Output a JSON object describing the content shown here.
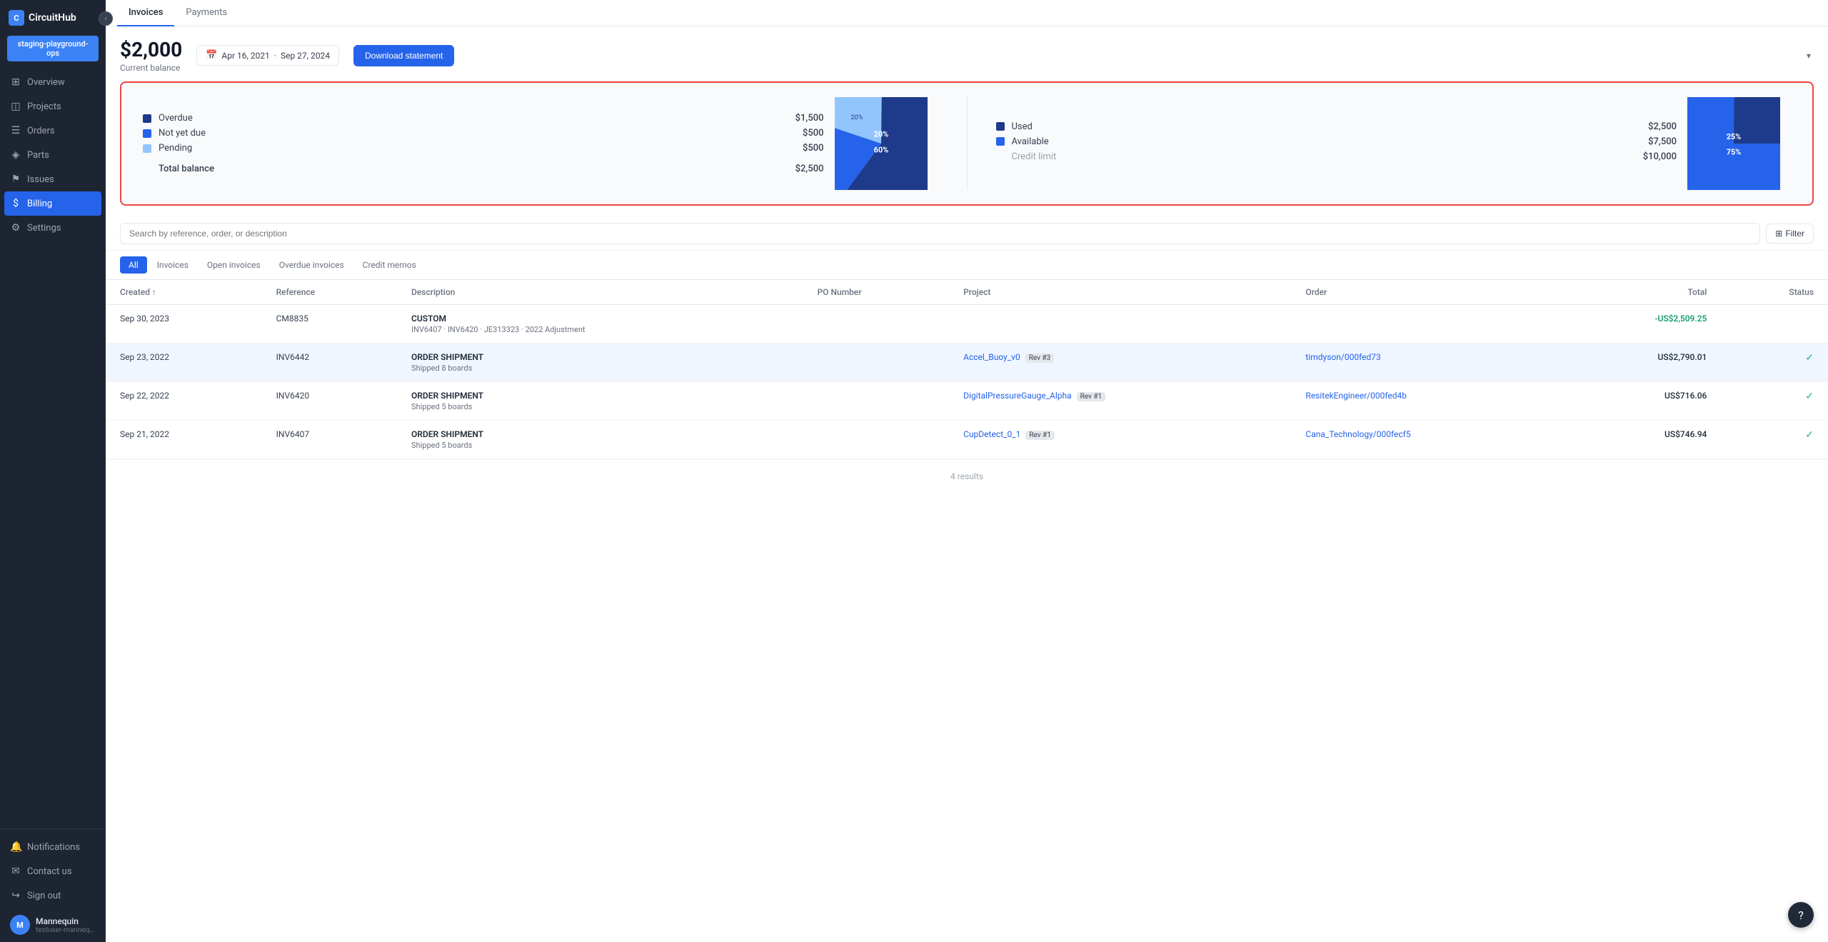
{
  "app": {
    "name": "CircuitHub",
    "logo_letter": "C"
  },
  "sidebar": {
    "workspace": "staging-playground-ops",
    "nav_items": [
      {
        "id": "overview",
        "label": "Overview",
        "icon": "⊞"
      },
      {
        "id": "projects",
        "label": "Projects",
        "icon": "◫"
      },
      {
        "id": "orders",
        "label": "Orders",
        "icon": "📋"
      },
      {
        "id": "parts",
        "label": "Parts",
        "icon": "⚙"
      },
      {
        "id": "issues",
        "label": "Issues",
        "icon": "⚠"
      },
      {
        "id": "billing",
        "label": "Billing",
        "icon": "$",
        "active": true
      },
      {
        "id": "settings",
        "label": "Settings",
        "icon": "⚙"
      }
    ],
    "bottom_items": [
      {
        "id": "notifications",
        "label": "Notifications",
        "icon": "🔔"
      },
      {
        "id": "contact",
        "label": "Contact us",
        "icon": "✉"
      },
      {
        "id": "signout",
        "label": "Sign out",
        "icon": "↪"
      }
    ],
    "user": {
      "name": "Mannequin",
      "email": "testuser-mannequin@circ...",
      "avatar_letter": "M"
    }
  },
  "header": {
    "tabs": [
      {
        "id": "invoices",
        "label": "Invoices",
        "active": true
      },
      {
        "id": "payments",
        "label": "Payments"
      }
    ],
    "balance": {
      "amount": "$2,000",
      "label": "Current balance"
    },
    "date_range": {
      "start": "Apr 16, 2021",
      "separator": "·",
      "end": "Sep 27, 2024"
    },
    "download_btn": "Download statement"
  },
  "summary": {
    "left": {
      "items": [
        {
          "label": "Overdue",
          "value": "$1,500",
          "color": "#1e3a8a"
        },
        {
          "label": "Not yet due",
          "value": "$500",
          "color": "#2563eb"
        },
        {
          "label": "Pending",
          "value": "$500",
          "color": "#93c5fd"
        }
      ],
      "total_label": "Total balance",
      "total_value": "$2,500"
    },
    "chart1": {
      "segments": [
        {
          "label": "Overdue 60%",
          "percent": 60,
          "color": "#1e3a8a"
        },
        {
          "label": "Not yet due 20%",
          "percent": 20,
          "color": "#2563eb"
        },
        {
          "label": "Pending 20%",
          "percent": 20,
          "color": "#93c5fd"
        }
      ]
    },
    "right": {
      "items": [
        {
          "label": "Used",
          "value": "$2,500",
          "color": "#1e3a8a"
        },
        {
          "label": "Available",
          "value": "$7,500",
          "color": "#2563eb"
        }
      ],
      "credit_limit_label": "Credit limit",
      "credit_limit_value": "$10,000"
    },
    "chart2": {
      "segments": [
        {
          "label": "Used 25%",
          "percent": 25,
          "color": "#1e3a8a"
        },
        {
          "label": "Available 75%",
          "percent": 75,
          "color": "#2563eb"
        }
      ]
    }
  },
  "filter": {
    "search_placeholder": "Search by reference, order, or description",
    "filter_btn": "Filter"
  },
  "sub_tabs": [
    {
      "id": "all",
      "label": "All",
      "active": true
    },
    {
      "id": "invoices",
      "label": "Invoices"
    },
    {
      "id": "open_invoices",
      "label": "Open invoices"
    },
    {
      "id": "overdue_invoices",
      "label": "Overdue invoices"
    },
    {
      "id": "credit_memos",
      "label": "Credit memos"
    }
  ],
  "table": {
    "columns": [
      {
        "id": "created",
        "label": "Created ↑"
      },
      {
        "id": "reference",
        "label": "Reference"
      },
      {
        "id": "description",
        "label": "Description"
      },
      {
        "id": "po_number",
        "label": "PO Number"
      },
      {
        "id": "project",
        "label": "Project"
      },
      {
        "id": "order",
        "label": "Order"
      },
      {
        "id": "total",
        "label": "Total",
        "align": "right"
      },
      {
        "id": "status",
        "label": "Status",
        "align": "right"
      }
    ],
    "rows": [
      {
        "created": "Sep 30, 2023",
        "reference": "CM8835",
        "desc_title": "CUSTOM",
        "desc_sub": "INV6407 · INV6420 · JE313323 · 2022 Adjustment",
        "po_number": "",
        "project": "",
        "project_link": false,
        "order": "",
        "order_link": false,
        "total": "-US$2,509.25",
        "total_class": "negative",
        "status": "",
        "highlighted": false
      },
      {
        "created": "Sep 23, 2022",
        "reference": "INV6442",
        "desc_title": "ORDER SHIPMENT",
        "desc_sub": "Shipped 8 boards",
        "po_number": "",
        "project": "Accel_Buoy_v0",
        "project_rev": "Rev #3",
        "project_link": true,
        "order": "timdyson/000fed73",
        "order_link": true,
        "total": "US$2,790.01",
        "total_class": "positive",
        "status": "✓",
        "highlighted": true
      },
      {
        "created": "Sep 22, 2022",
        "reference": "INV6420",
        "desc_title": "ORDER SHIPMENT",
        "desc_sub": "Shipped 5 boards",
        "po_number": "",
        "project": "DigitalPressureGauge_Alpha",
        "project_rev": "Rev #1",
        "project_link": true,
        "order": "ResitekEngineer/000fed4b",
        "order_link": true,
        "total": "US$716.06",
        "total_class": "positive",
        "status": "✓",
        "highlighted": false
      },
      {
        "created": "Sep 21, 2022",
        "reference": "INV6407",
        "desc_title": "ORDER SHIPMENT",
        "desc_sub": "Shipped 5 boards",
        "po_number": "",
        "project": "CupDetect_0_1",
        "project_rev": "Rev #1",
        "project_link": true,
        "order": "Cana_Technology/000fecf5",
        "order_link": true,
        "total": "US$746.94",
        "total_class": "positive",
        "status": "✓",
        "highlighted": false
      }
    ],
    "footer": "4 results"
  }
}
